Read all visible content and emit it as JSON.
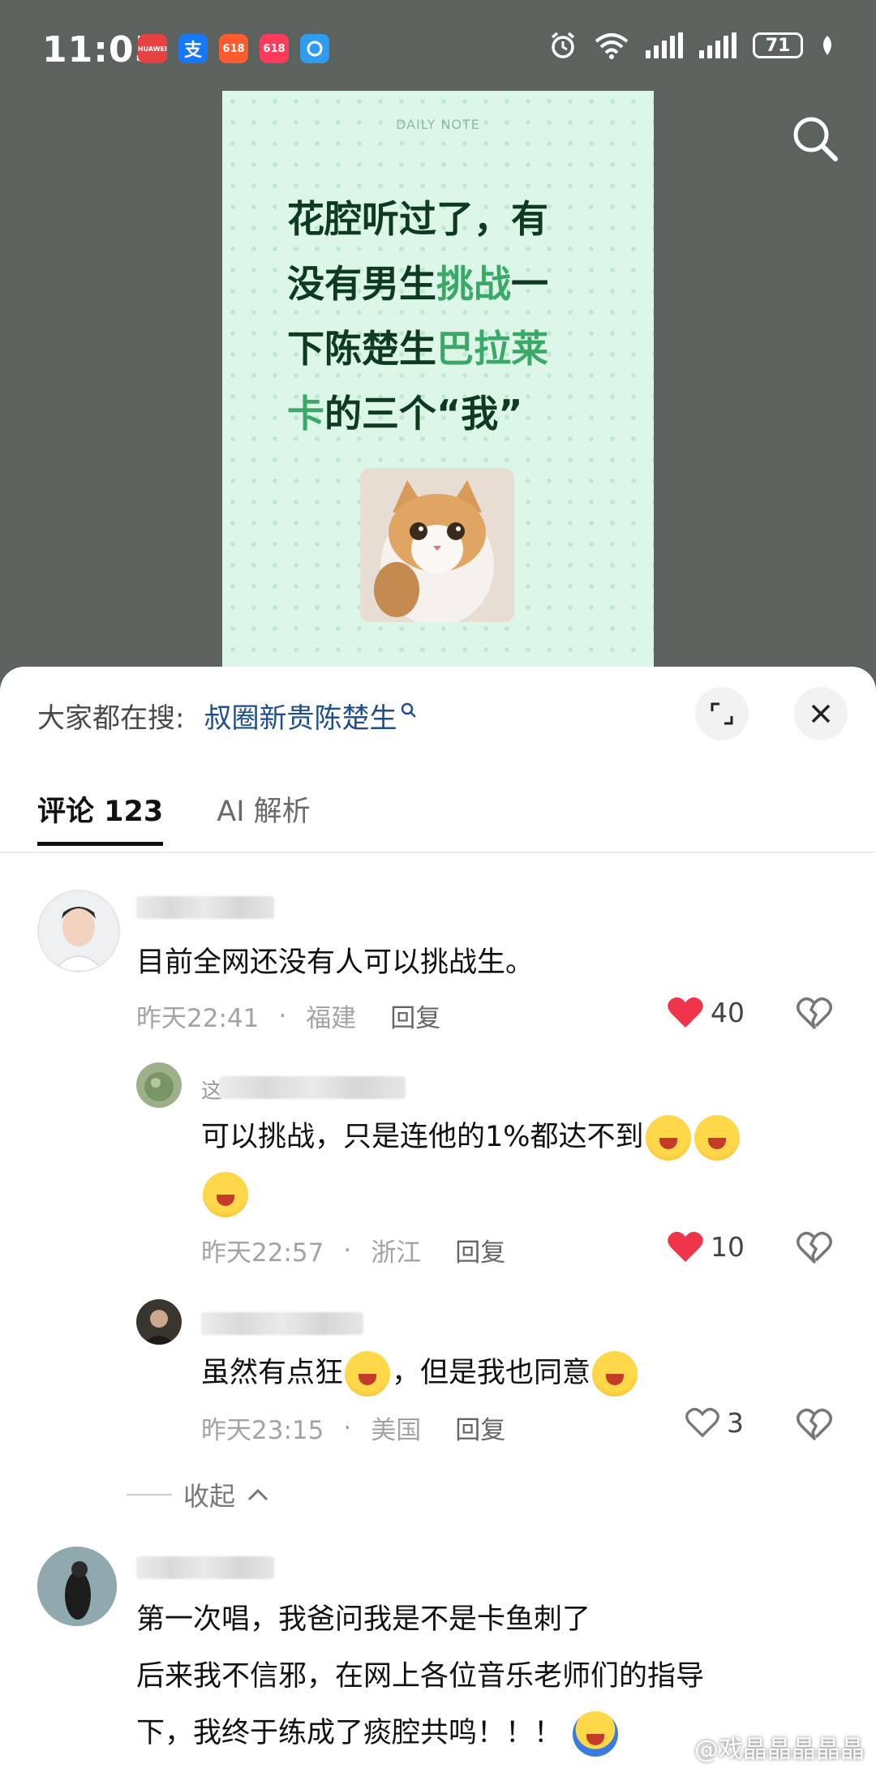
{
  "status_bar": {
    "time": "11:05",
    "battery": "71",
    "app_icons": [
      {
        "name": "huawei-appgallery-icon",
        "label": "HUAWEI",
        "color": "#e84141"
      },
      {
        "name": "alipay-icon",
        "label": "支",
        "color": "#1677ff"
      },
      {
        "name": "taobao-618-icon",
        "label": "618",
        "color": "#ff5b2e"
      },
      {
        "name": "tmall-618-icon",
        "label": "618",
        "color": "#ff3b5c"
      },
      {
        "name": "browser-icon",
        "label": "",
        "color": "#2e9df0"
      }
    ]
  },
  "note": {
    "label": "DAILY NOTE",
    "title_lines": [
      {
        "a": "花腔听过了，有",
        "hl": "",
        "b": ""
      },
      {
        "a": "没有男生",
        "hl": "挑战",
        "b": "一"
      },
      {
        "a": "下陈楚生",
        "hl": "巴拉莱",
        "b": ""
      },
      {
        "a": "",
        "hl": "卡",
        "b": "的三个“我”"
      }
    ]
  },
  "sheet": {
    "hot_label": "大家都在搜:",
    "hot_keyword": "叔圈新贵陈楚生",
    "tabs": [
      {
        "label": "评论 123"
      },
      {
        "label": "AI 解析"
      }
    ]
  },
  "comments": [
    {
      "text": "目前全网还没有人可以挑战生。",
      "time": "昨天22:41",
      "location": "福建",
      "reply": "回复",
      "likes": "40",
      "liked": true
    },
    {
      "name_prefix": "这",
      "text_line1": "可以挑战，只是连他的1%都达不到",
      "time": "昨天22:57",
      "location": "浙江",
      "reply": "回复",
      "likes": "10",
      "liked": true
    },
    {
      "text_a": "虽然有点狂",
      "text_b": "，但是我也同意",
      "time": "昨天23:15",
      "location": "美国",
      "reply": "回复",
      "likes": "3",
      "liked": false
    },
    {
      "text_lines": [
        "第一次唱，我爸问我是不是卡鱼刺了",
        "后来我不信邪，在网上各位音乐老师们的指导",
        "下，我终于练成了痰腔共鸣！！！"
      ]
    }
  ],
  "collapse_label": "收起",
  "watermark": "@戏晶晶晶晶晶",
  "colors": {
    "like_red": "#f0344c",
    "keyword_blue": "#1e4f8a",
    "note_green": "#3aa968"
  }
}
